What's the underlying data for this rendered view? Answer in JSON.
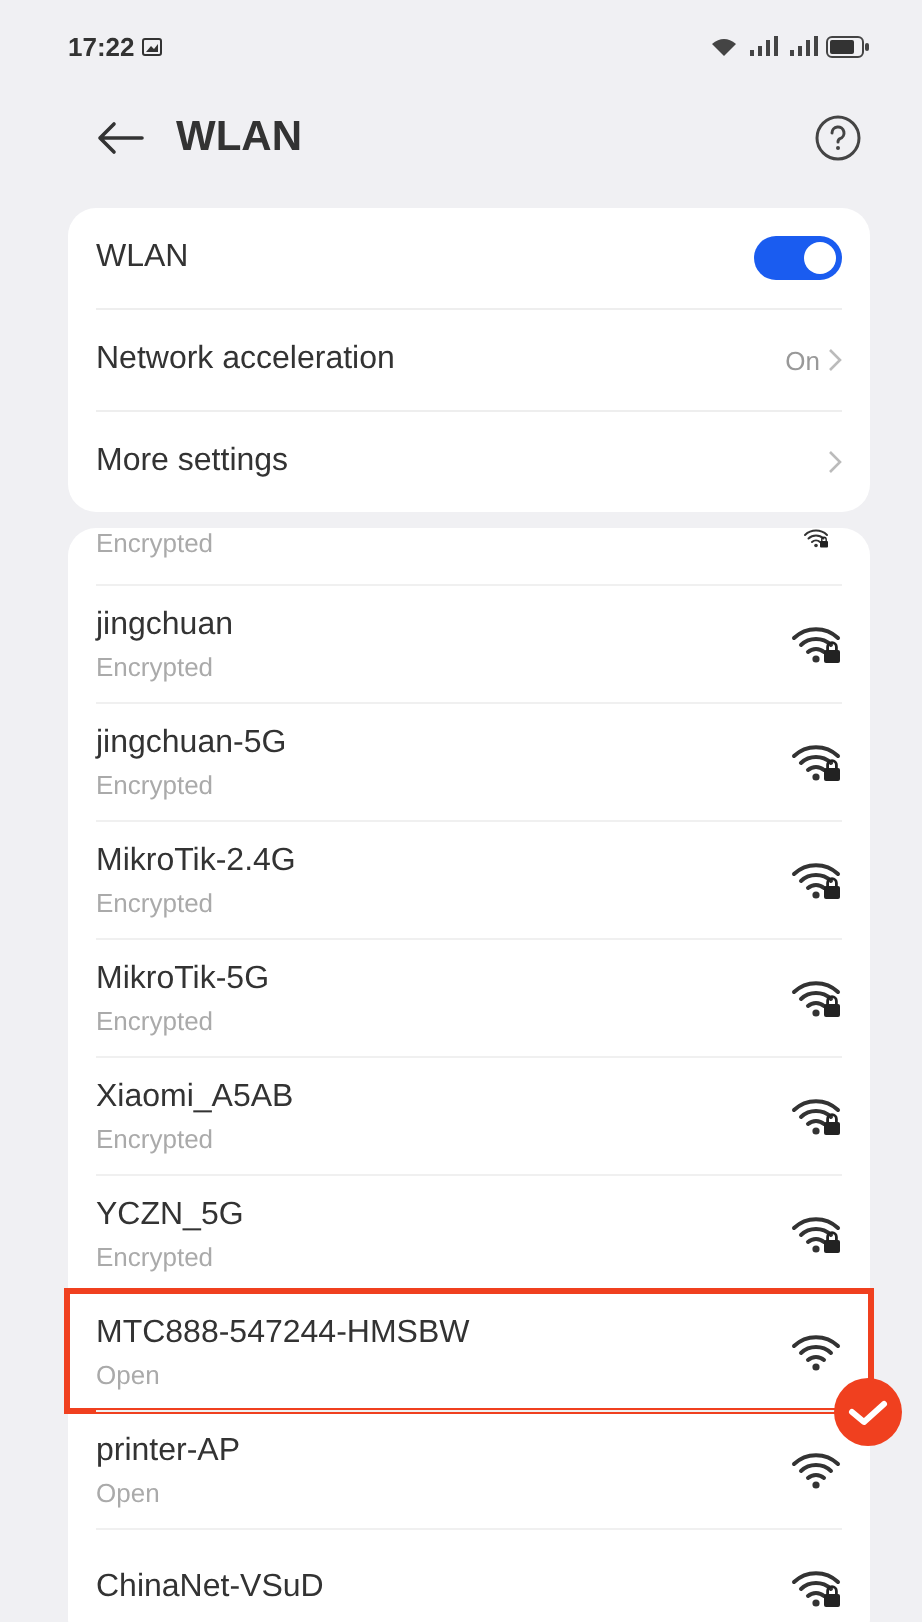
{
  "status_bar": {
    "time": "17:22"
  },
  "header": {
    "title": "WLAN"
  },
  "settings": [
    {
      "kind": "toggle",
      "label": "WLAN",
      "on": true
    },
    {
      "kind": "link",
      "label": "Network acceleration",
      "value": "On"
    },
    {
      "kind": "link",
      "label": "More settings"
    }
  ],
  "networks": [
    {
      "status": "Encrypted",
      "locked": true,
      "highlighted": false,
      "partial": true
    },
    {
      "name": "jingchuan",
      "status": "Encrypted",
      "locked": true,
      "highlighted": false
    },
    {
      "name": "jingchuan-5G",
      "status": "Encrypted",
      "locked": true,
      "highlighted": false
    },
    {
      "name": "MikroTik-2.4G",
      "status": "Encrypted",
      "locked": true,
      "highlighted": false
    },
    {
      "name": "MikroTik-5G",
      "status": "Encrypted",
      "locked": true,
      "highlighted": false
    },
    {
      "name": "Xiaomi_A5AB",
      "status": "Encrypted",
      "locked": true,
      "highlighted": false
    },
    {
      "name": "YCZN_5G",
      "status": "Encrypted",
      "locked": true,
      "highlighted": false
    },
    {
      "name": "MTC888-547244-HMSBW",
      "status": "Open",
      "locked": false,
      "highlighted": true
    },
    {
      "name": "printer-AP",
      "status": "Open",
      "locked": false,
      "highlighted": false
    },
    {
      "name": "ChinaNet-VSuD",
      "locked": true,
      "highlighted": false
    }
  ]
}
